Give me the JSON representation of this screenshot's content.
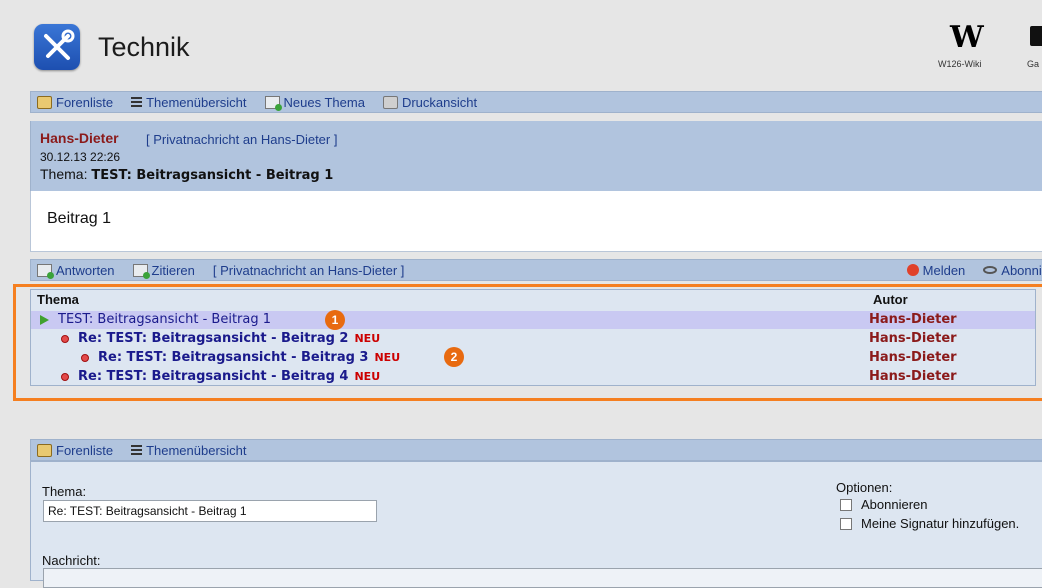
{
  "header": {
    "title": "Technik",
    "wiki_logo": "W",
    "wiki_label": "W126-Wiki",
    "ga_label": "Ga"
  },
  "toolbar_top": {
    "forenliste": "Forenliste",
    "themenuebersicht": "Themenübersicht",
    "neues_thema": "Neues Thema",
    "druckansicht": "Druckansicht"
  },
  "post": {
    "author": "Hans-Dieter",
    "pm_link": "[ Privatnachricht an Hans-Dieter ]",
    "date": "30.12.13 22:26",
    "topic_label": "Thema:",
    "topic_title": "TEST: Beitragsansicht - Beitrag 1",
    "body": "Beitrag 1"
  },
  "post_actions": {
    "antworten": "Antworten",
    "zitieren": "Zitieren",
    "pm_link": "[ Privatnachricht an Hans-Dieter ]",
    "melden": "Melden",
    "abonnieren": "Abonnie"
  },
  "thread": {
    "col_thema": "Thema",
    "col_autor": "Autor",
    "rows": [
      {
        "title": "TEST: Beitragsansicht - Beitrag 1",
        "author": "Hans-Dieter",
        "neu": ""
      },
      {
        "title": "Re: TEST: Beitragsansicht - Beitrag 2",
        "author": "Hans-Dieter",
        "neu": "NEU"
      },
      {
        "title": "Re: TEST: Beitragsansicht - Beitrag 3",
        "author": "Hans-Dieter",
        "neu": "NEU"
      },
      {
        "title": "Re: TEST: Beitragsansicht - Beitrag 4",
        "author": "Hans-Dieter",
        "neu": "NEU"
      }
    ],
    "markers": [
      "1",
      "2"
    ]
  },
  "toolbar_bottom": {
    "forenliste": "Forenliste",
    "themenuebersicht": "Themenübersicht"
  },
  "reply_form": {
    "thema_label": "Thema:",
    "thema_value": "Re: TEST: Beitragsansicht - Beitrag 1",
    "optionen_label": "Optionen:",
    "opt_abonnieren": "Abonnieren",
    "opt_signatur": "Meine Signatur hinzufügen.",
    "nachricht_label": "Nachricht:"
  },
  "colors": {
    "bar": "#b1c4de",
    "author": "#8b1a1a",
    "link": "#1e3d8c",
    "highlight": "#f57f20",
    "selected_row": "#c9c9f2"
  },
  "icons": [
    "tools-icon",
    "home-icon",
    "list-icon",
    "mail-plus-icon",
    "print-icon",
    "warning-icon",
    "eye-icon",
    "arrow-right-icon",
    "bullet-icon",
    "checkbox-icon"
  ]
}
